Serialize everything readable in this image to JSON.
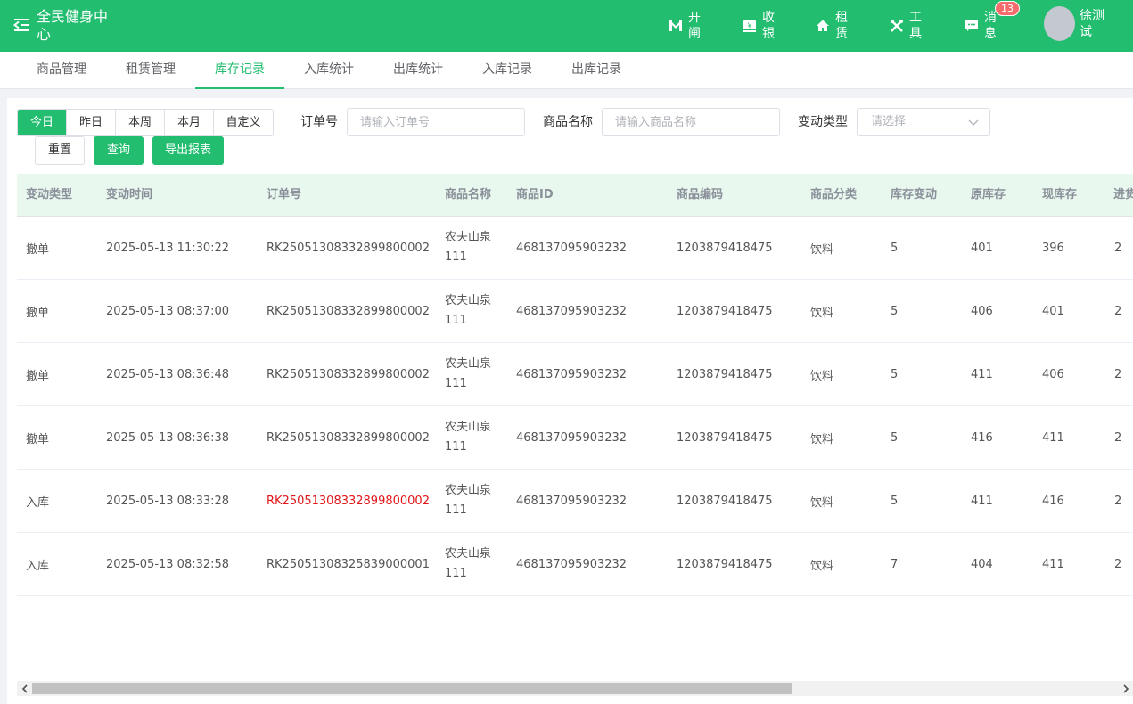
{
  "app": {
    "title": "全民健身中心"
  },
  "topnav": [
    {
      "label": "开闸",
      "icon": "gate-icon"
    },
    {
      "label": "收银",
      "icon": "cashier-icon"
    },
    {
      "label": "租赁",
      "icon": "home-icon"
    },
    {
      "label": "工具",
      "icon": "tools-icon"
    },
    {
      "label": "消息",
      "icon": "message-icon"
    }
  ],
  "messages": {
    "badge": "13"
  },
  "user": {
    "name": "徐测试"
  },
  "tabs": [
    "商品管理",
    "租赁管理",
    "库存记录",
    "入库统计",
    "出库统计",
    "入库记录",
    "出库记录"
  ],
  "active_tab": "库存记录",
  "filters": {
    "date_buttons": [
      "今日",
      "昨日",
      "本周",
      "本月",
      "自定义"
    ],
    "active_date": "今日",
    "order_label": "订单号",
    "order_placeholder": "请输入订单号",
    "product_label": "商品名称",
    "product_placeholder": "请输入商品名称",
    "type_label": "变动类型",
    "type_placeholder": "请选择",
    "reset": "重置",
    "search": "查询",
    "export": "导出报表"
  },
  "table": {
    "columns": [
      "变动类型",
      "变动时间",
      "订单号",
      "商品名称",
      "商品ID",
      "商品编码",
      "商品分类",
      "库存变动",
      "原库存",
      "现库存",
      "进货"
    ],
    "rows": [
      [
        "撤单",
        "2025-05-13 11:30:22",
        "RK25051308332899800002",
        "农夫山泉111",
        "468137095903232",
        "1203879418475",
        "饮料",
        "5",
        "401",
        "396",
        "2"
      ],
      [
        "撤单",
        "2025-05-13 08:37:00",
        "RK25051308332899800002",
        "农夫山泉111",
        "468137095903232",
        "1203879418475",
        "饮料",
        "5",
        "406",
        "401",
        "2"
      ],
      [
        "撤单",
        "2025-05-13 08:36:48",
        "RK25051308332899800002",
        "农夫山泉111",
        "468137095903232",
        "1203879418475",
        "饮料",
        "5",
        "411",
        "406",
        "2"
      ],
      [
        "撤单",
        "2025-05-13 08:36:38",
        "RK25051308332899800002",
        "农夫山泉111",
        "468137095903232",
        "1203879418475",
        "饮料",
        "5",
        "416",
        "411",
        "2"
      ],
      [
        "入库",
        "2025-05-13 08:33:28",
        "RK25051308332899800002",
        "农夫山泉111",
        "468137095903232",
        "1203879418475",
        "饮料",
        "5",
        "411",
        "416",
        "2"
      ],
      [
        "入库",
        "2025-05-13 08:32:58",
        "RK25051308325839000001",
        "农夫山泉111",
        "468137095903232",
        "1203879418475",
        "饮料",
        "7",
        "404",
        "411",
        "2"
      ]
    ],
    "highlight_row": 4,
    "highlight_color": "#e0171a"
  },
  "colors": {
    "brand": "#22bd6f",
    "header_bg": "#e8f8ef",
    "badge": "#f56c6c"
  }
}
